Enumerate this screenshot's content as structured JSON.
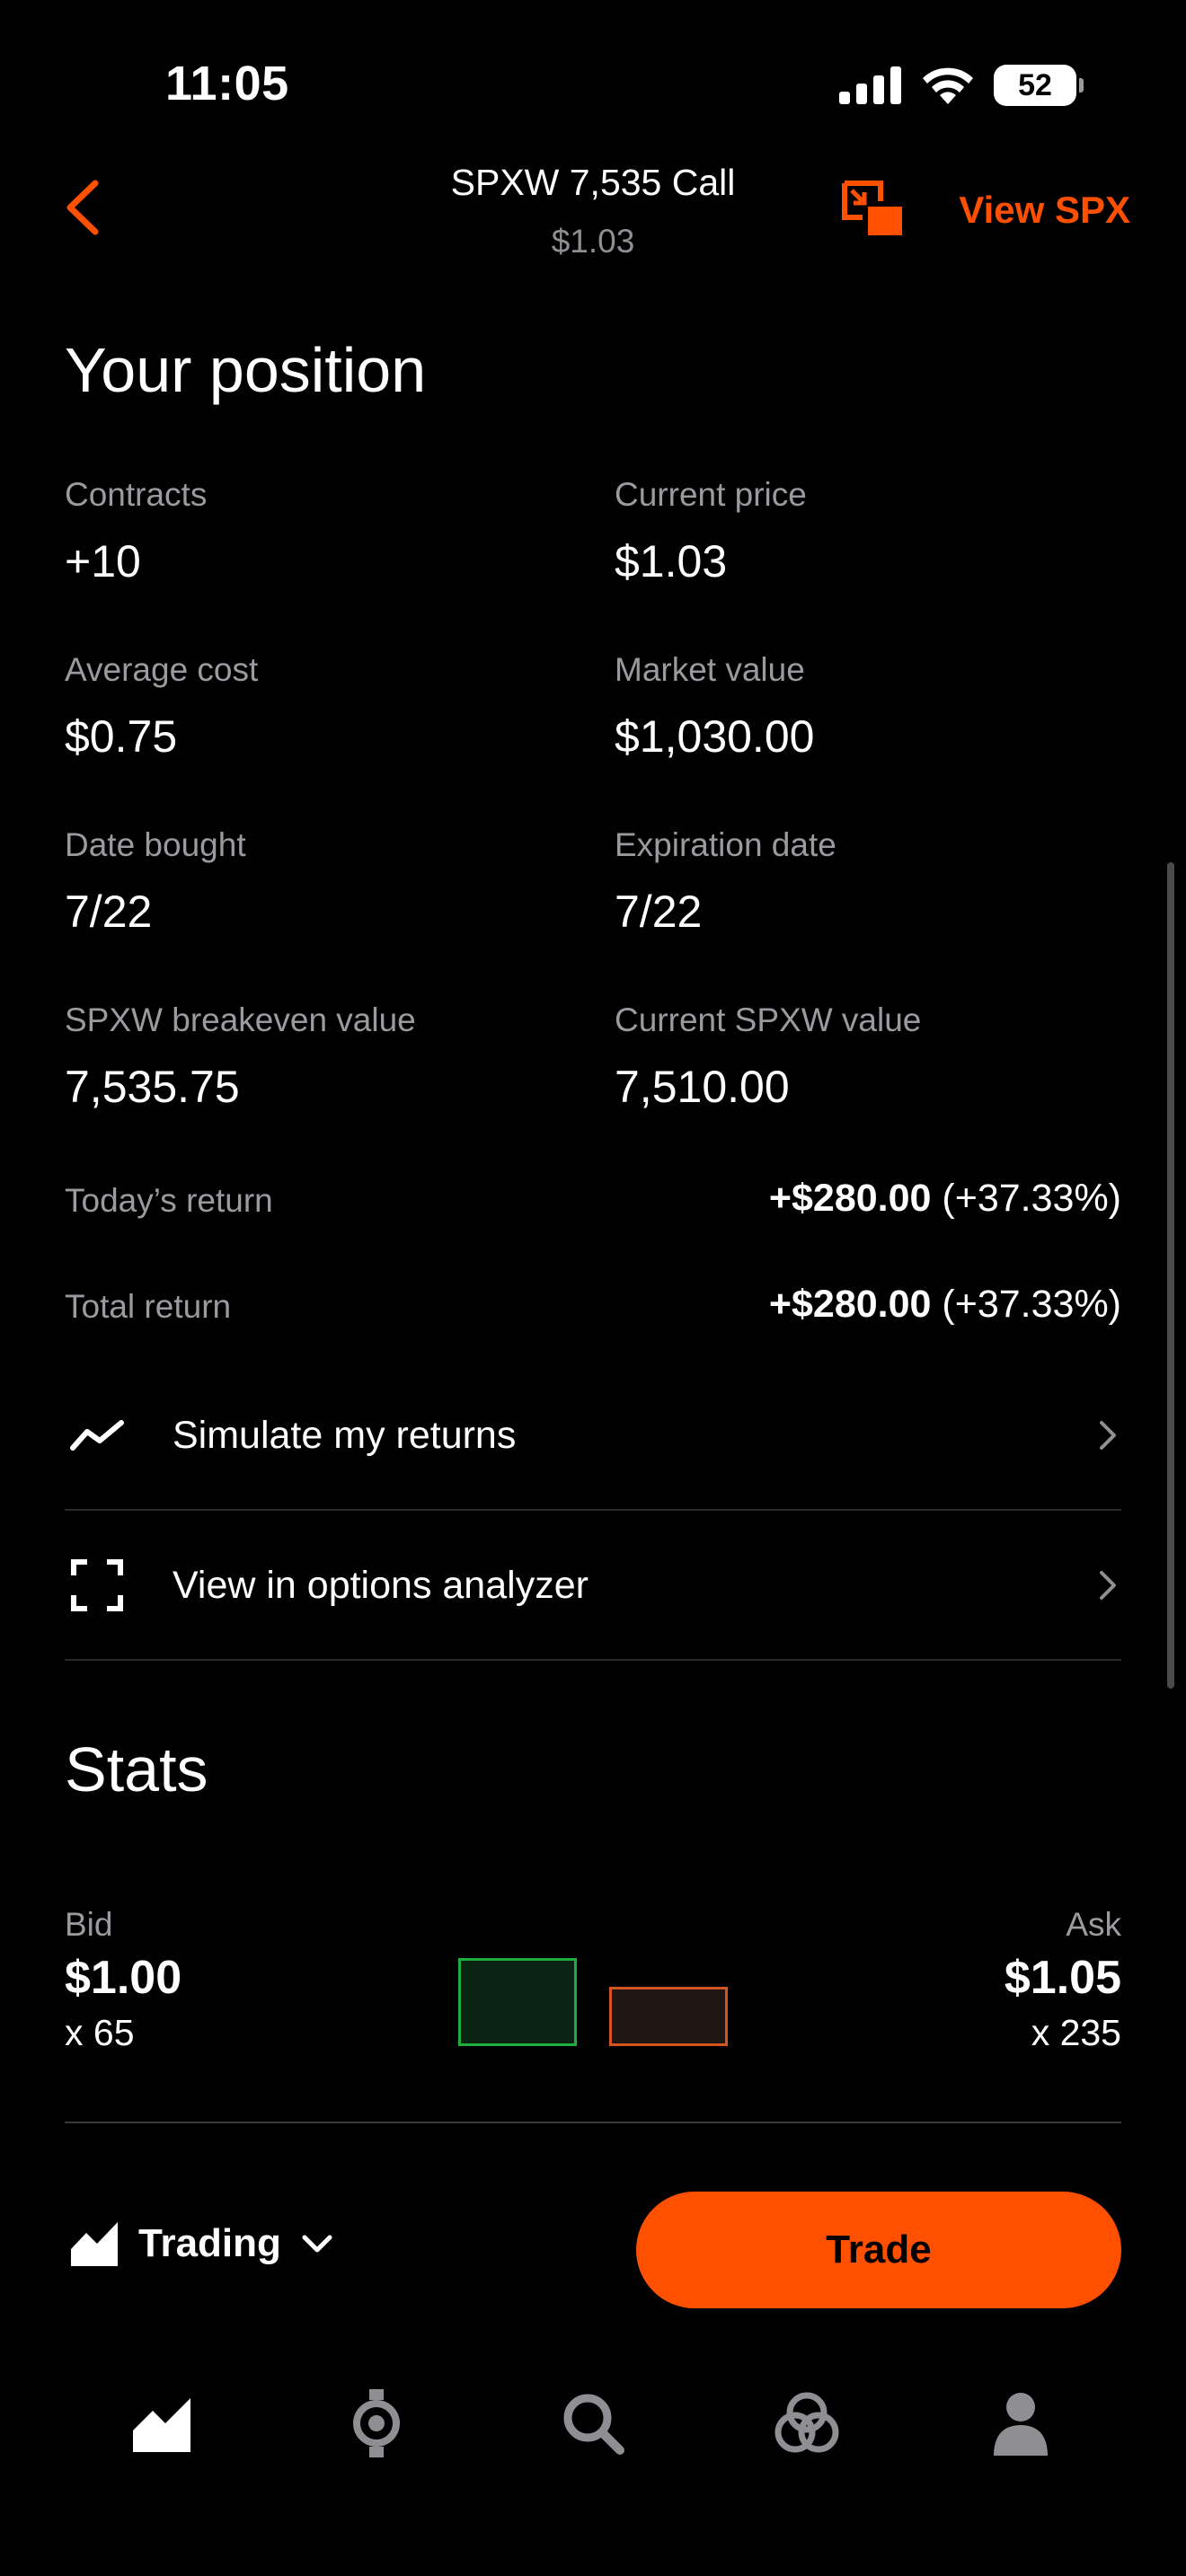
{
  "status_bar": {
    "time": "11:05",
    "battery": "52"
  },
  "header": {
    "title": "SPXW 7,535 Call",
    "subtitle": "$1.03",
    "view_link": "View SPX",
    "back_icon": "chevron-left-icon",
    "pip_icon": "picture-in-picture-icon"
  },
  "position": {
    "title": "Your position",
    "cells": [
      {
        "label": "Contracts",
        "value": "+10"
      },
      {
        "label": "Current price",
        "value": "$1.03"
      },
      {
        "label": "Average cost",
        "value": "$0.75"
      },
      {
        "label": "Market value",
        "value": "$1,030.00"
      },
      {
        "label": "Date bought",
        "value": "7/22"
      },
      {
        "label": "Expiration date",
        "value": "7/22"
      },
      {
        "label": "SPXW breakeven value",
        "value": "7,535.75"
      },
      {
        "label": "Current SPXW value",
        "value": "7,510.00"
      }
    ],
    "returns": [
      {
        "label": "Today’s return",
        "amount": "+$280.00",
        "percent": "(+37.33%)"
      },
      {
        "label": "Total return",
        "amount": "+$280.00",
        "percent": "(+37.33%)"
      }
    ]
  },
  "actions": [
    {
      "label": "Simulate my returns",
      "icon": "trend-line-icon"
    },
    {
      "label": "View in options analyzer",
      "icon": "viewfinder-icon"
    }
  ],
  "stats": {
    "title": "Stats",
    "bid": {
      "label": "Bid",
      "price": "$1.00",
      "size": "x 65"
    },
    "ask": {
      "label": "Ask",
      "price": "$1.05",
      "size": "x 235"
    }
  },
  "trade_bar": {
    "mode_label": "Trading",
    "trade_button": "Trade"
  },
  "tab_bar": [
    {
      "name": "investing",
      "icon": "chart-icon"
    },
    {
      "name": "crypto",
      "icon": "rocket-icon"
    },
    {
      "name": "search",
      "icon": "search-icon"
    },
    {
      "name": "network",
      "icon": "circles-icon"
    },
    {
      "name": "account",
      "icon": "person-icon"
    }
  ],
  "colors": {
    "accent": "#ff5000",
    "background": "#000000",
    "muted_text": "#9a9a9f",
    "bid_border": "#1fae3a",
    "ask_border": "#d4531f"
  }
}
